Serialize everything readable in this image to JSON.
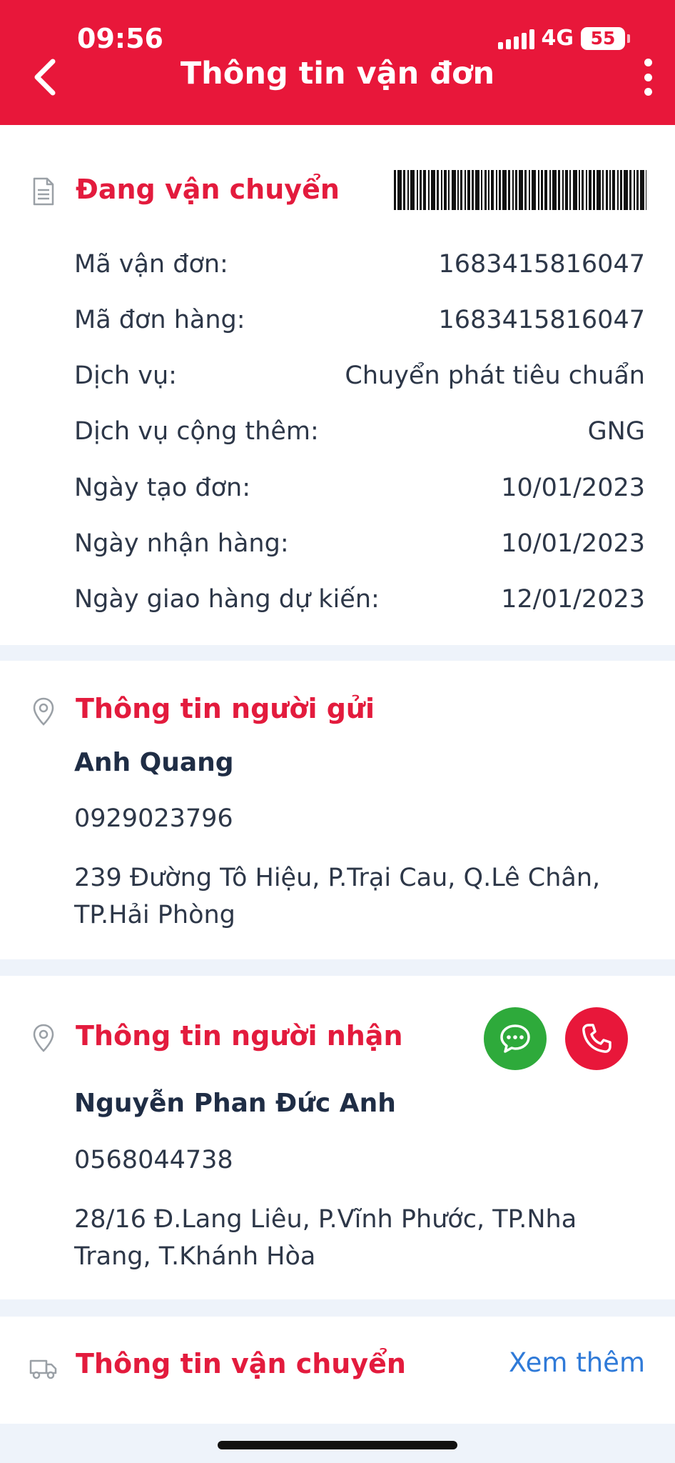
{
  "status_bar": {
    "time": "09:56",
    "network": "4G",
    "battery": "55"
  },
  "header": {
    "title": "Thông tin vận đơn"
  },
  "shipment": {
    "status": "Đang vận chuyển",
    "rows": [
      {
        "label": "Mã vận đơn:",
        "value": "1683415816047"
      },
      {
        "label": "Mã đơn hàng:",
        "value": "1683415816047"
      },
      {
        "label": "Dịch vụ:",
        "value": "Chuyển phát tiêu chuẩn"
      },
      {
        "label": "Dịch vụ cộng thêm:",
        "value": "GNG"
      },
      {
        "label": "Ngày tạo đơn:",
        "value": "10/01/2023"
      },
      {
        "label": "Ngày nhận hàng:",
        "value": "10/01/2023"
      },
      {
        "label": "Ngày giao hàng dự kiến:",
        "value": "12/01/2023"
      }
    ]
  },
  "sender": {
    "title": "Thông tin người gửi",
    "name": "Anh Quang",
    "phone": "0929023796",
    "address": "239 Đường Tô Hiệu, P.Trại Cau, Q.Lê Chân, TP.Hải Phòng"
  },
  "receiver": {
    "title": "Thông tin người nhận",
    "name": "Nguyễn Phan Đức Anh",
    "phone": "0568044738",
    "address": "28/16 Đ.Lang Liêu, P.Vĩnh Phước, TP.Nha Trang, T.Khánh Hòa"
  },
  "transport": {
    "title": "Thông tin vận chuyển",
    "more_label": "Xem thêm"
  },
  "icons": {
    "back": "chevron-left-icon",
    "more": "more-vertical-icon",
    "document": "document-icon",
    "location": "location-pin-icon",
    "chat": "chat-icon",
    "phone": "phone-icon",
    "truck": "truck-icon"
  },
  "colors": {
    "brand_red": "#e8173a",
    "chat_green": "#2eaa3b",
    "link_blue": "#2f7ad8"
  }
}
